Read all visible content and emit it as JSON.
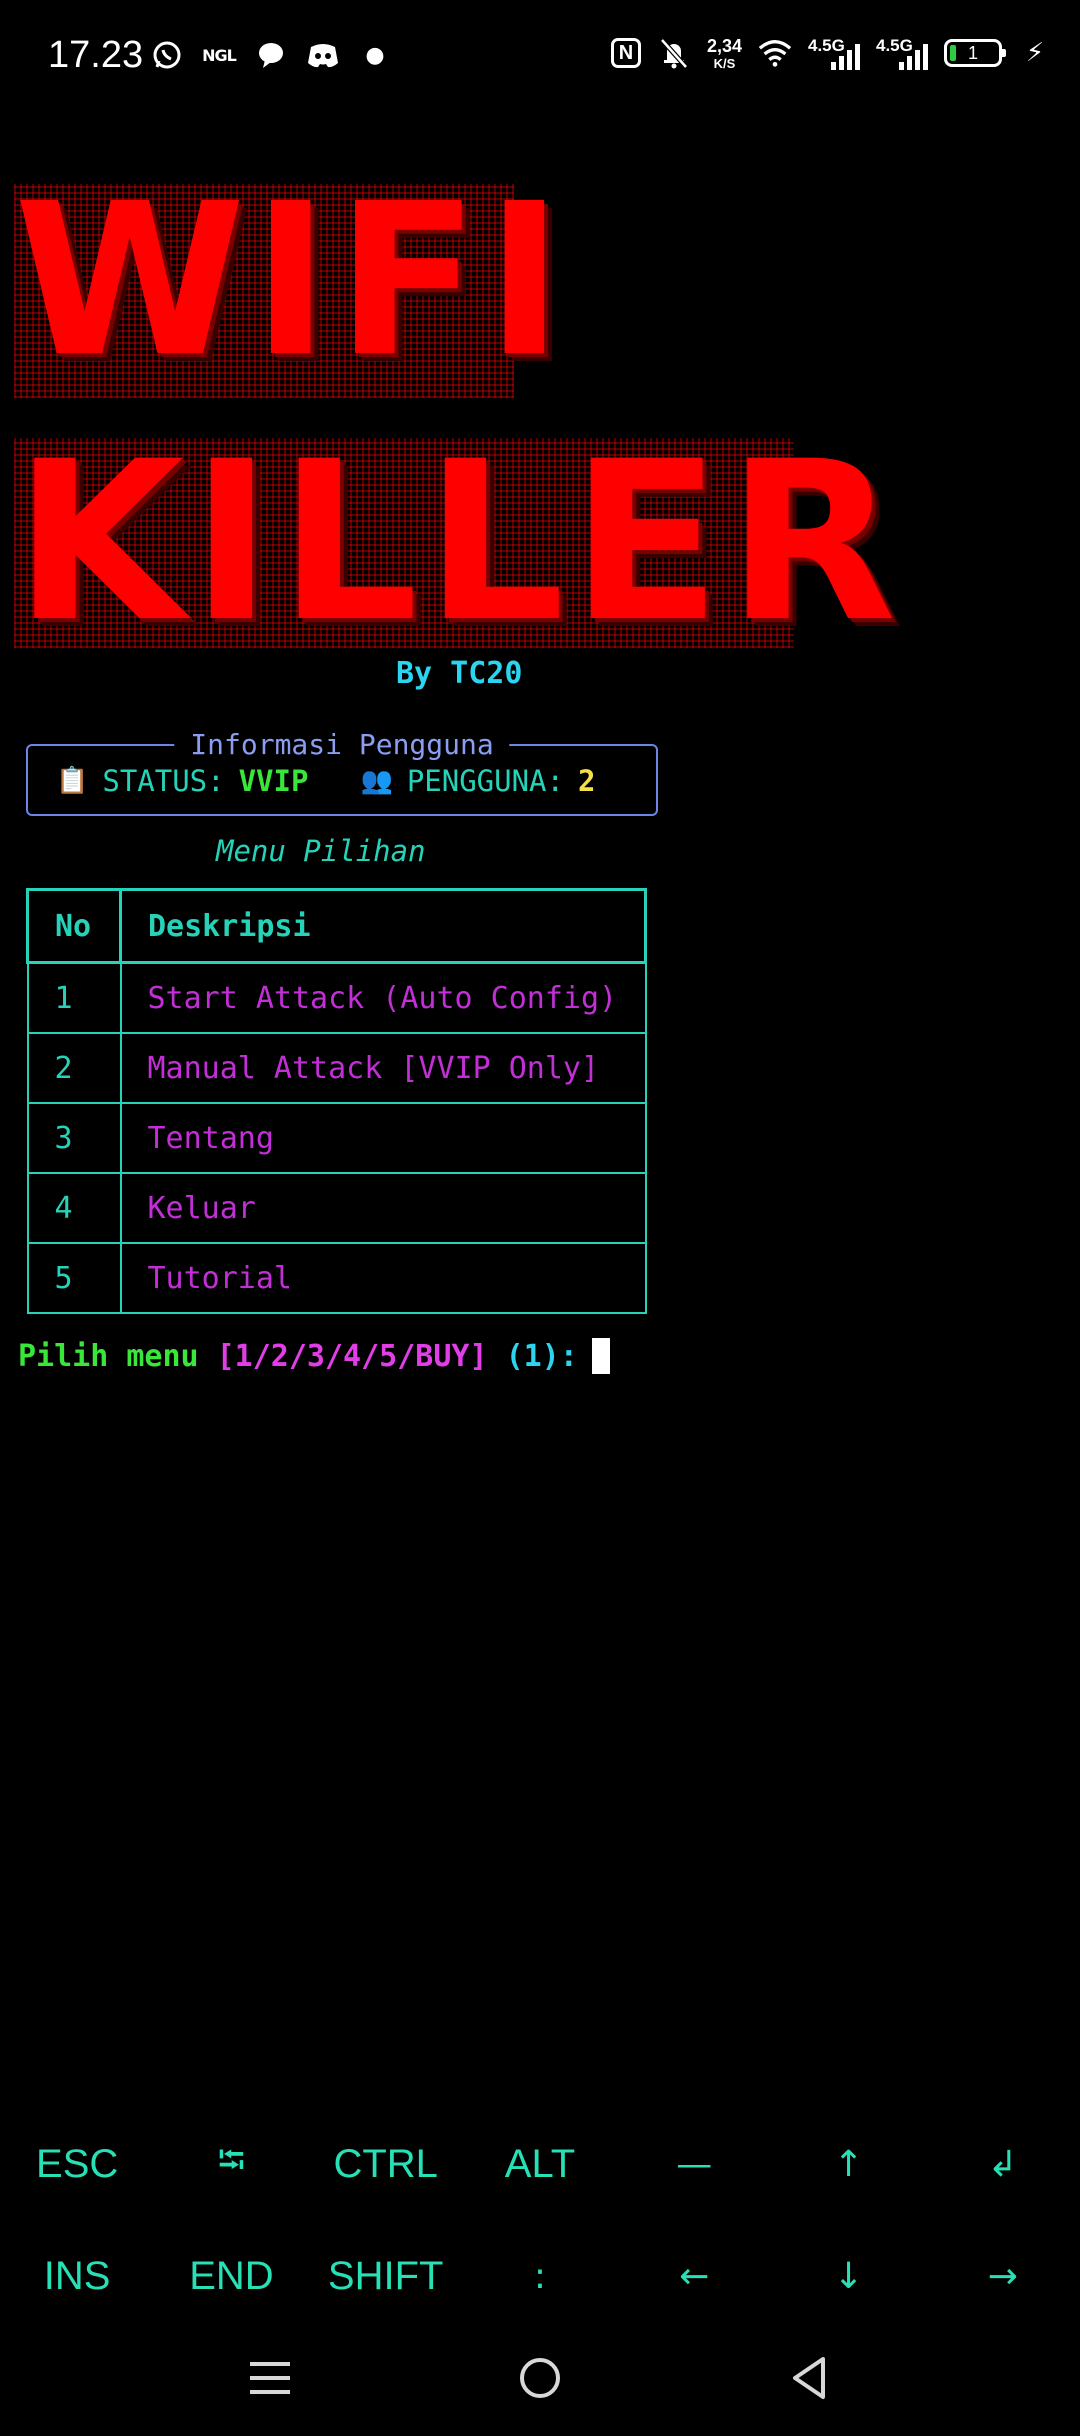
{
  "status_bar": {
    "time": "17.23",
    "app_icons": [
      "whatsapp-icon",
      "ngl-icon",
      "chat-bubble-icon",
      "discord-icon",
      "dot-icon"
    ],
    "ngl_label": "NGL",
    "nfc_label": "N",
    "net_speed_value": "2,34",
    "net_speed_unit": "K/S",
    "sim1_label": "4.5G",
    "sim2_label": "4.5G",
    "battery_level": "1",
    "accent_battery": "#2ecc40"
  },
  "banner": {
    "line1": "WIFI",
    "line2": "KILLER",
    "byline": "By TC20",
    "color": "#ff0000"
  },
  "info_panel": {
    "title": "Informasi Pengguna",
    "status_label": "STATUS:",
    "status_value": "VVIP",
    "users_label": "PENGGUNA:",
    "users_value": "2",
    "status_emoji": "📋",
    "users_emoji": "👥"
  },
  "menu": {
    "title": "Menu Pilihan",
    "headers": {
      "no": "No",
      "desc": "Deskripsi"
    },
    "items": [
      {
        "no": "1",
        "desc": "Start Attack (Auto Config)"
      },
      {
        "no": "2",
        "desc": "Manual Attack [VVIP Only]"
      },
      {
        "no": "3",
        "desc": "Tentang"
      },
      {
        "no": "4",
        "desc": "Keluar"
      },
      {
        "no": "5",
        "desc": "Tutorial"
      }
    ]
  },
  "prompt": {
    "label": "Pilih menu",
    "options": "[1/2/3/4/5/BUY]",
    "default": "(1):"
  },
  "extra_keys": {
    "row1": [
      "ESC",
      "⭾",
      "CTRL",
      "ALT",
      "—",
      "↑",
      "↲"
    ],
    "row2": [
      "INS",
      "END",
      "SHIFT",
      ":",
      "←",
      "↓",
      "→"
    ],
    "color": "#27e0b5"
  },
  "nav_bar": [
    "menu-icon",
    "home-icon",
    "back-icon"
  ]
}
